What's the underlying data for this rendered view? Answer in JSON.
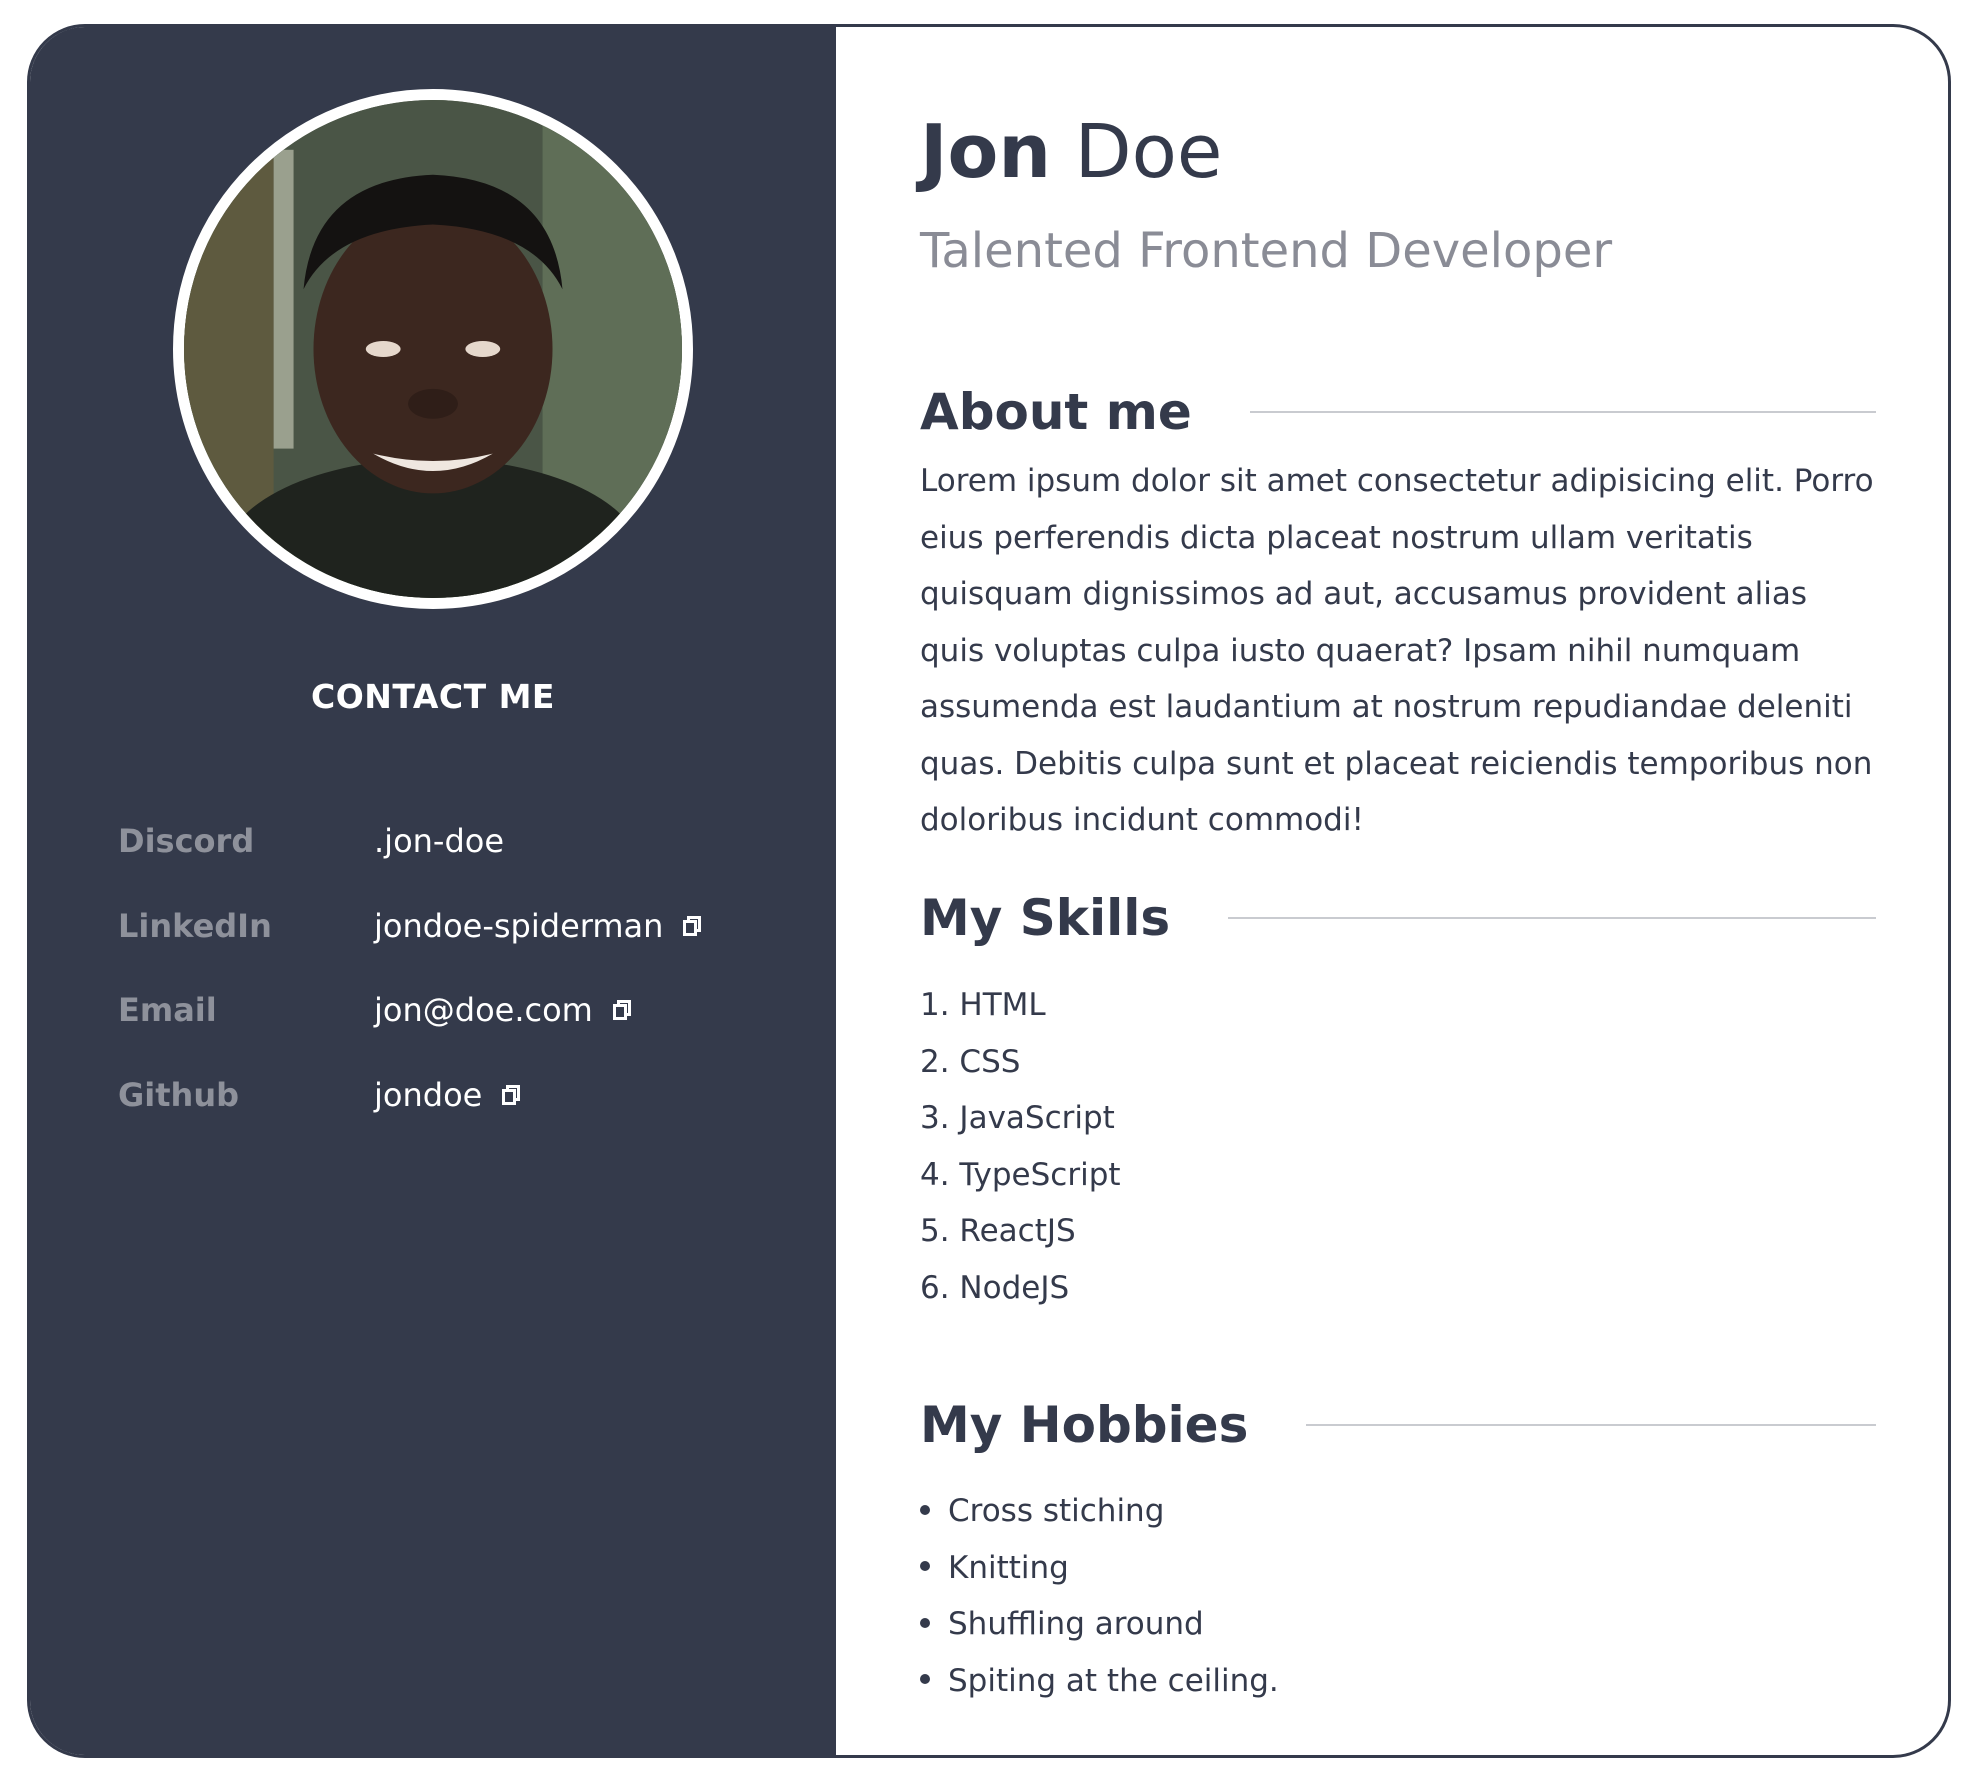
{
  "sidebar": {
    "contact_title": "CONTACT ME",
    "contacts": [
      {
        "label": "Discord",
        "value": ".jon-doe",
        "link": false
      },
      {
        "label": "LinkedIn",
        "value": "jondoe-spiderman",
        "link": true
      },
      {
        "label": "Email",
        "value": "jon@doe.com",
        "link": true
      },
      {
        "label": "Github",
        "value": "jondoe",
        "link": true
      }
    ]
  },
  "header": {
    "first_name": "Jon",
    "last_name": "Doe",
    "subtitle": "Talented Frontend Developer"
  },
  "about": {
    "title": "About me",
    "text": "Lorem ipsum dolor sit amet consectetur adipisicing elit. Porro eius perferendis dicta placeat nostrum ullam veritatis quisquam dignissimos ad aut, accusamus provident alias quis voluptas culpa iusto quaerat? Ipsam nihil numquam assumenda est laudantium at nostrum repudiandae deleniti quas. Debitis culpa sunt et placeat reiciendis temporibus non doloribus incidunt commodi!"
  },
  "skills": {
    "title": "My Skills",
    "items": [
      "1. HTML",
      "2. CSS",
      "3. JavaScript",
      "4. TypeScript",
      "5. ReactJS",
      "6. NodeJS"
    ]
  },
  "hobbies": {
    "title": "My Hobbies",
    "items": [
      "Cross stiching",
      "Knitting",
      "Shuffling around",
      "Spiting at the ceiling."
    ]
  },
  "colors": {
    "sidebar_bg": "#343a4b",
    "text_primary": "#343a4b",
    "text_muted": "#8a8c96",
    "contact_label": "#8e919b",
    "rule": "#c9cbd0"
  },
  "icons": {
    "external_link": "external-link-icon",
    "bullet": "bullet-icon"
  }
}
